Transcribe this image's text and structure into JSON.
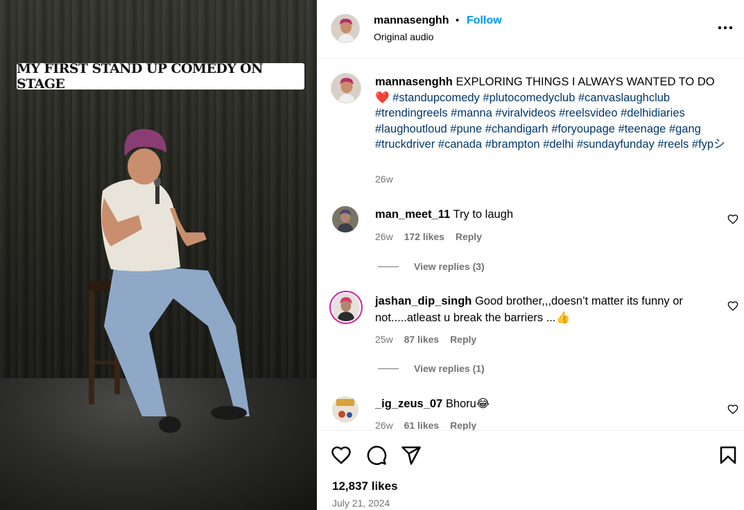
{
  "media": {
    "caption_overlay": "MY FIRST STAND UP COMEDY ON STAGE"
  },
  "header": {
    "username": "mannasenghh",
    "separator": "•",
    "follow_label": "Follow",
    "audio": "Original audio",
    "more_icon": "more-horizontal-icon"
  },
  "caption": {
    "username": "mannasenghh",
    "text": "EXPLORING THINGS I ALWAYS WANTED TO DO",
    "emoji": "❤️",
    "hashtags": [
      "#standupcomedy",
      "#plutocomedyclub",
      "#canvaslaughclub",
      "#trendingreels",
      "#manna",
      "#viralvideos",
      "#reelsvideo",
      "#delhidiaries",
      "#laughoutloud",
      "#pune",
      "#chandigarh",
      "#foryoupage",
      "#teenage",
      "#gang",
      "#truckdriver",
      "#canada",
      "#brampton",
      "#delhi",
      "#sundayfunday",
      "#reels",
      "#fypシ"
    ],
    "time": "26w"
  },
  "comments": [
    {
      "username": "man_meet_11",
      "text": "Try to laugh",
      "time": "26w",
      "likes": "172 likes",
      "reply": "Reply",
      "view_replies": "View replies (3)"
    },
    {
      "username": "jashan_dip_singh",
      "text": "Good brother,,,doesn’t matter its funny or not.....atleast u break the barriers ...👍",
      "time": "25w",
      "likes": "87 likes",
      "reply": "Reply",
      "view_replies": "View replies (1)"
    },
    {
      "username": "_ig_zeus_07",
      "text": "Bhoru😂",
      "time": "26w",
      "likes": "61 likes",
      "reply": "Reply"
    }
  ],
  "footer": {
    "likes": "12,837 likes",
    "date": "July 21, 2024"
  },
  "colors": {
    "link_blue": "#0095f6",
    "hashtag": "#00376b",
    "muted": "#737373"
  }
}
